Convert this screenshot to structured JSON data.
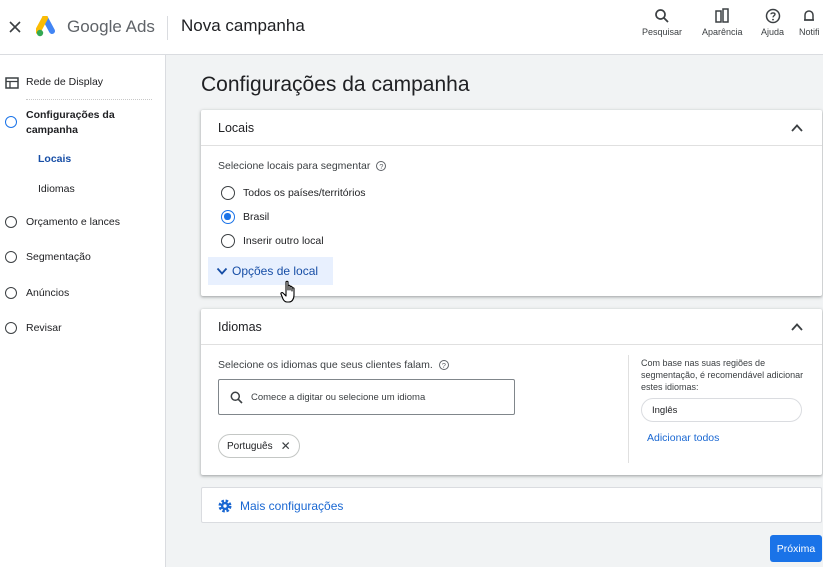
{
  "topbar": {
    "brand": "Google Ads",
    "campaign_title": "Nova campanha",
    "actions": [
      {
        "label": "Pesquisar",
        "icon": "search-icon"
      },
      {
        "label": "Aparência",
        "icon": "appearance-icon"
      },
      {
        "label": "Ajuda",
        "icon": "help-icon"
      },
      {
        "label": "Notifi",
        "icon": "notifications-icon"
      }
    ]
  },
  "sidebar": {
    "items": [
      {
        "label": "Rede de Display",
        "icon": "display-network-icon"
      },
      {
        "label": "Configurações da campanha",
        "state": "active"
      },
      {
        "label": "Orçamento e lances"
      },
      {
        "label": "Segmentação"
      },
      {
        "label": "Anúncios"
      },
      {
        "label": "Revisar"
      }
    ],
    "subitems": [
      {
        "label": "Locais",
        "state": "active"
      },
      {
        "label": "Idiomas"
      }
    ]
  },
  "main": {
    "title": "Configurações da campanha",
    "locations": {
      "header": "Locais",
      "instruction": "Selecione locais para segmentar",
      "options": [
        {
          "label": "Todos os países/territórios",
          "checked": false
        },
        {
          "label": "Brasil",
          "checked": true
        },
        {
          "label": "Inserir outro local",
          "checked": false
        }
      ],
      "options_toggle": "Opções de local"
    },
    "languages": {
      "header": "Idiomas",
      "instruction": "Selecione os idiomas que seus clientes falam.",
      "search_placeholder": "Comece a digitar ou selecione um idioma",
      "selected": [
        "Português"
      ],
      "recommendation_text": "Com base nas suas regiões de segmentação, é recomendável adicionar estes idiomas:",
      "recommended": [
        "Inglês"
      ],
      "add_all": "Adicionar todos"
    },
    "more_settings": "Mais configurações",
    "next_button": "Próxima"
  },
  "colors": {
    "primary": "#1a73e8",
    "link": "#1967d2",
    "highlight_bg": "#e8f0fe",
    "page_bg": "#f1f3f4"
  }
}
